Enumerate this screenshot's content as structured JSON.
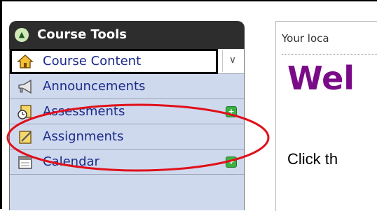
{
  "sidebar": {
    "header": "Course Tools",
    "items": [
      {
        "label": "Course Content",
        "icon": "home-icon",
        "active": true
      },
      {
        "label": "Announcements",
        "icon": "megaphone-icon"
      },
      {
        "label": "Assessments",
        "icon": "assessment-icon",
        "badge": true
      },
      {
        "label": "Assignments",
        "icon": "assignment-icon"
      },
      {
        "label": "Calendar",
        "icon": "calendar-icon",
        "badge": true
      }
    ]
  },
  "content": {
    "location": "Your loca",
    "welcome": "Wel",
    "click": "Click th"
  },
  "colors": {
    "header_bg": "#2d2d2d",
    "item_bg": "#cfd9ee",
    "link": "#1a2a8a",
    "welcome": "#7a0a88",
    "badge": "#3cb043",
    "highlight": "#e0101a"
  }
}
